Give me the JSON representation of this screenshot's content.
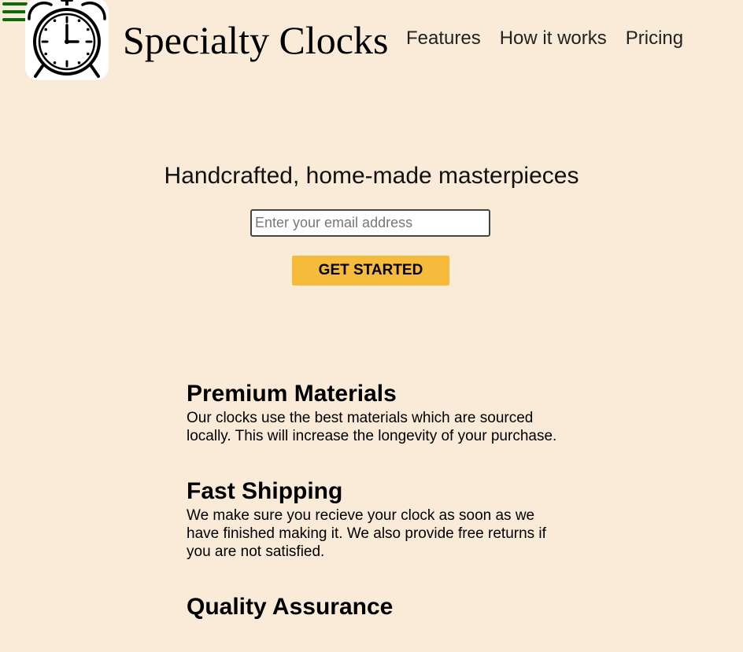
{
  "header": {
    "brand": "Specialty Clocks",
    "nav": [
      {
        "label": "Features"
      },
      {
        "label": "How it works"
      },
      {
        "label": "Pricing"
      }
    ]
  },
  "icons": {
    "menu": "hamburger-menu-icon",
    "logo": "alarm-clock-icon"
  },
  "colors": {
    "background": "#f9ebd7",
    "menu_icon": "#0b6b0b",
    "cta_button": "#f7bb3c"
  },
  "hero": {
    "title": "Handcrafted, home-made masterpieces",
    "email_placeholder": "Enter your email address",
    "email_value": "",
    "cta_label": "GET STARTED"
  },
  "features": [
    {
      "title": "Premium Materials",
      "text": "Our clocks use the best materials which are sourced locally. This will increase the longevity of your purchase."
    },
    {
      "title": "Fast Shipping",
      "text": "We make sure you recieve your clock as soon as we have finished making it. We also provide free returns if you are not satisfied."
    },
    {
      "title": "Quality Assurance",
      "text": ""
    }
  ]
}
